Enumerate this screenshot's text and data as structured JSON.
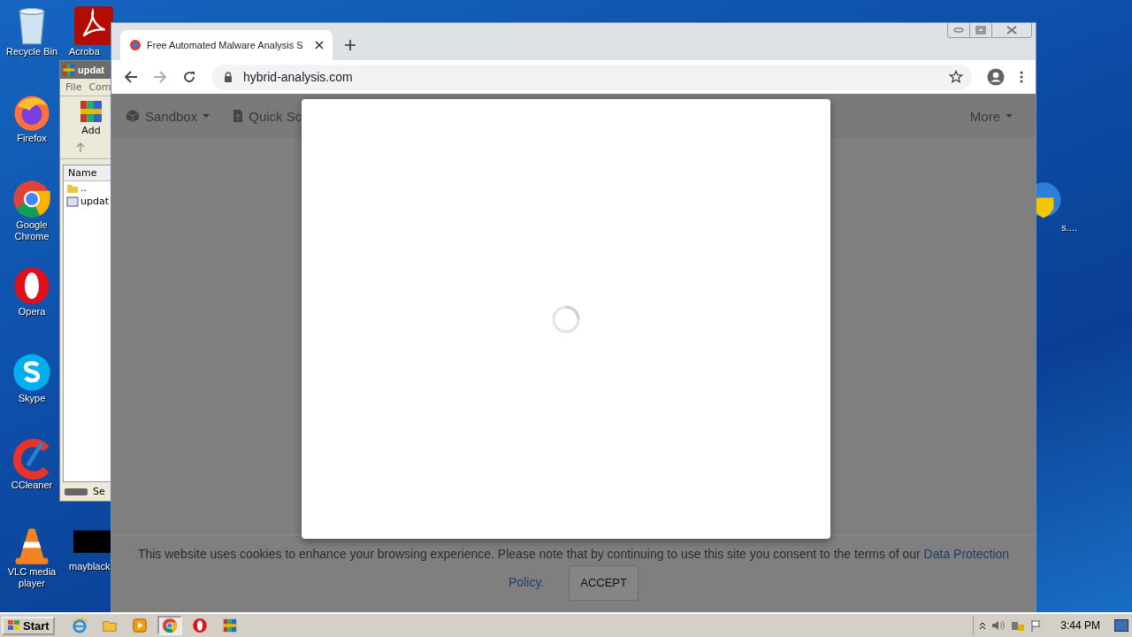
{
  "desktop": {
    "column_1": [
      {
        "label": "Recycle Bin",
        "kind": "bin"
      },
      {
        "label": "Firefox",
        "kind": "firefox"
      },
      {
        "label": "Google Chrome",
        "kind": "chrome"
      },
      {
        "label": "Opera",
        "kind": "opera"
      },
      {
        "label": "Skype",
        "kind": "skype"
      },
      {
        "label": "CCleaner",
        "kind": "ccleaner"
      },
      {
        "label": "VLC media player",
        "kind": "vlc"
      }
    ],
    "column_2": [
      {
        "label": "Acroba",
        "kind": "acrobat"
      },
      {
        "label": "mayblack",
        "kind": "black"
      }
    ],
    "right_icon": {
      "label": "s....",
      "kind": "shield"
    }
  },
  "archiver": {
    "title": "updat",
    "menu": [
      "File",
      "Com"
    ],
    "toolbar": [
      "Add"
    ],
    "column": "Name",
    "rows": [
      {
        "name": "..",
        "kind": "folder"
      },
      {
        "name": "updat",
        "kind": "file"
      }
    ],
    "status": "Se"
  },
  "browser": {
    "tab": {
      "title": "Free Automated Malware Analysis S"
    },
    "address": "hybrid-analysis.com",
    "nav": [
      {
        "label": "Sandbox",
        "dropdown": true
      },
      {
        "label": "Quick Sc"
      }
    ],
    "nav_right": {
      "label": "More",
      "dropdown": true
    },
    "modal": {
      "loading": true
    },
    "cookie": {
      "text": "This website uses cookies to enhance your browsing experience. Please note that by continuing to use this site you consent to the terms of our",
      "links": [
        "Data Protection",
        "Policy."
      ],
      "button": "ACCEPT"
    }
  },
  "taskbar": {
    "start": "Start",
    "apps": [
      {
        "kind": "ie",
        "selected": false
      },
      {
        "kind": "explorer",
        "selected": false
      },
      {
        "kind": "media",
        "selected": false
      },
      {
        "kind": "chrome",
        "selected": true
      },
      {
        "kind": "opera",
        "selected": false
      },
      {
        "kind": "winrar",
        "selected": false
      }
    ],
    "time": "3:44 PM"
  }
}
